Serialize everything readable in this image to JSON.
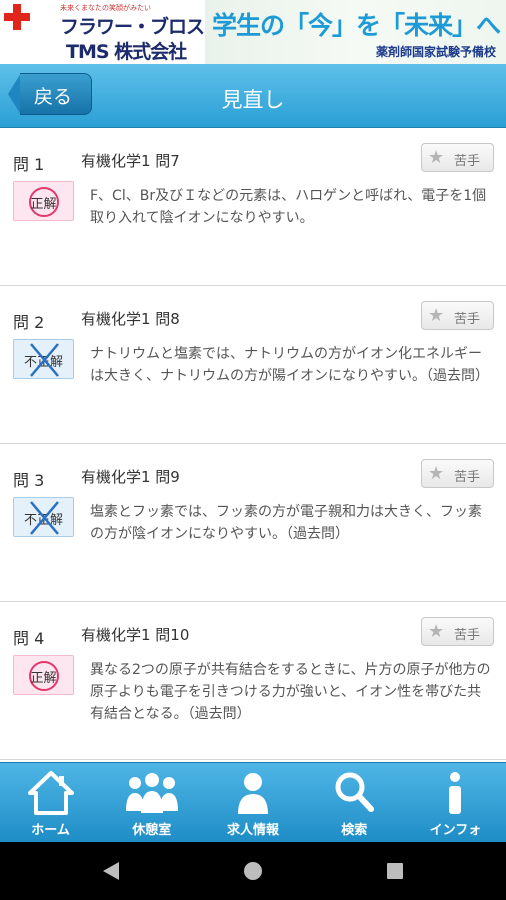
{
  "banner": {
    "tagline": "未来くまなたの笑顔がみたい",
    "brand_line1": "フラワー・ブロス",
    "brand_line2": "TMS 株式会社",
    "slogan": "学生の「今」を「未来」へ",
    "subtitle": "薬剤師国家試験予備校",
    "accent_color": "#1e9bd6"
  },
  "header": {
    "back_label": "戻る",
    "title": "見直し",
    "bar_color": "#2b9fd4"
  },
  "questions": [
    {
      "number": "問 1",
      "title": "有機化学1 問7",
      "result": "正解",
      "result_type": "correct",
      "fav_label": "苦手",
      "text": "F、Cl、Br及びＩなどの元素は、ハロゲンと呼ばれ、電子を1個取り入れて陰イオンになりやすい。"
    },
    {
      "number": "問 2",
      "title": "有機化学1 問8",
      "result": "不正解",
      "result_type": "wrong",
      "fav_label": "苦手",
      "text": "ナトリウムと塩素では、ナトリウムの方がイオン化エネルギーは大きく、ナトリウムの方が陽イオンになりやすい。（過去問）"
    },
    {
      "number": "問 3",
      "title": "有機化学1 問9",
      "result": "不正解",
      "result_type": "wrong",
      "fav_label": "苦手",
      "text": "塩素とフッ素では、フッ素の方が電子親和力は大きく、フッ素の方が陰イオンになりやすい。（過去問）"
    },
    {
      "number": "問 4",
      "title": "有機化学1 問10",
      "result": "正解",
      "result_type": "correct",
      "fav_label": "苦手",
      "text": "異なる2つの原子が共有結合をするときに、片方の原子が他方の原子よりも電子を引きつける力が強いと、イオン性を帯びた共有結合となる。（過去問）"
    }
  ],
  "tabs": [
    {
      "label": "ホーム",
      "icon": "home-icon"
    },
    {
      "label": "休憩室",
      "icon": "group-icon"
    },
    {
      "label": "求人情報",
      "icon": "person-icon"
    },
    {
      "label": "検索",
      "icon": "search-icon"
    },
    {
      "label": "インフォ",
      "icon": "info-icon"
    }
  ],
  "system_nav": [
    "back-triangle-icon",
    "home-circle-icon",
    "recents-square-icon"
  ]
}
